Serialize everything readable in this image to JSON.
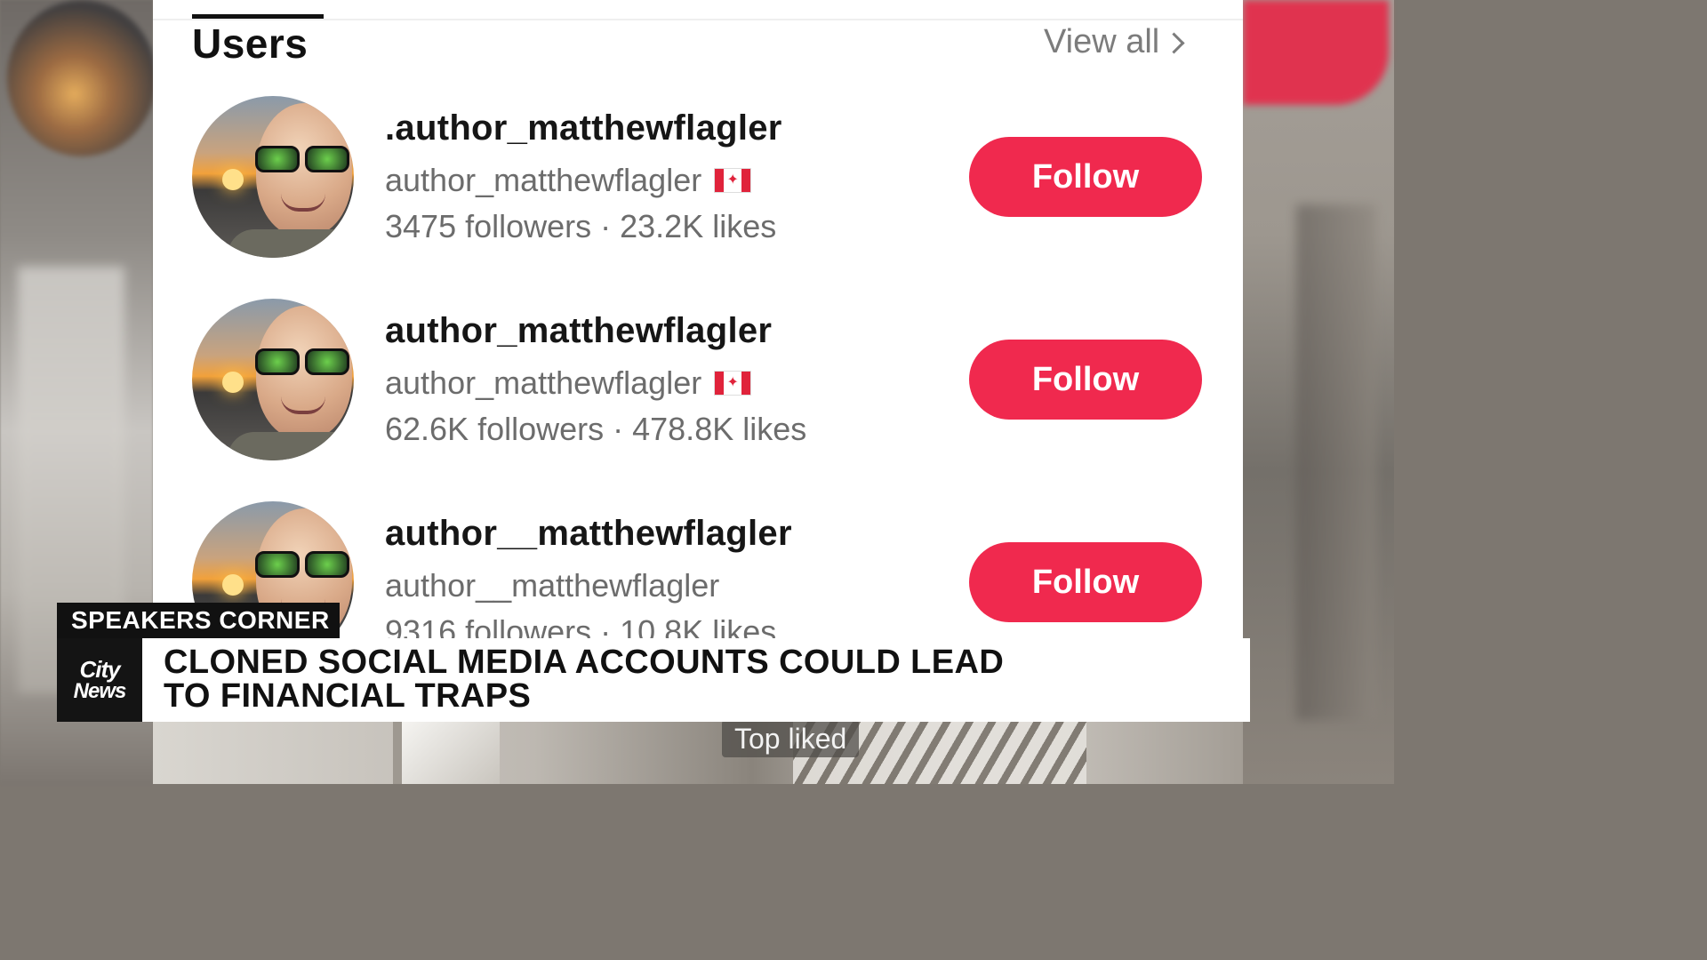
{
  "section": {
    "title": "Users",
    "view_all_label": "View all"
  },
  "users": [
    {
      "display_name": ".author_matthewflagler",
      "handle": "author_matthewflagler",
      "country_flag": "canada-flag-icon",
      "stats": "3475 followers · 23.2K likes",
      "follow_label": "Follow"
    },
    {
      "display_name": "author_matthewflagler",
      "handle": "author_matthewflagler",
      "country_flag": "canada-flag-icon",
      "stats": "62.6K followers · 478.8K likes",
      "follow_label": "Follow"
    },
    {
      "display_name": "author__matthewflagler",
      "handle": "author__matthewflagler",
      "stats": "9316 followers · 10.8K likes",
      "follow_label": "Follow"
    }
  ],
  "background": {
    "top_liked_label": "Top liked"
  },
  "lower_third": {
    "tag": "SPEAKERS CORNER",
    "logo_line1": "City",
    "logo_line2": "News",
    "headline_line1": "CLONED SOCIAL MEDIA ACCOUNTS COULD LEAD",
    "headline_line2": "TO FINANCIAL TRAPS"
  },
  "colors": {
    "follow_button": "#f0294e",
    "panel_bg": "#ffffff",
    "lower_third_dark": "#111111"
  }
}
